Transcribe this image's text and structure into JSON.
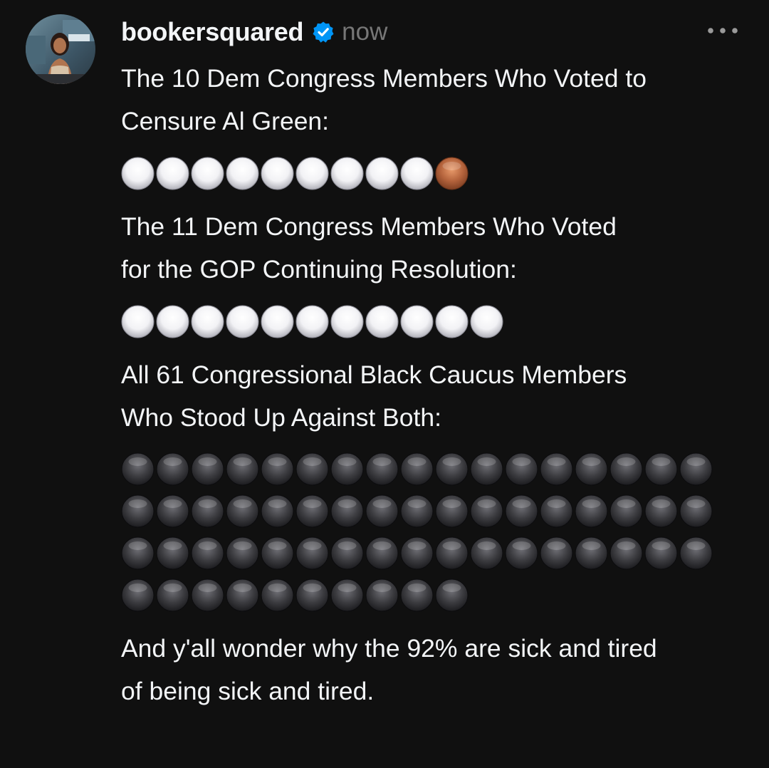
{
  "post": {
    "username": "bookersquared",
    "timestamp": "now",
    "verified": true,
    "more_icon": "more-horizontal-icon",
    "paragraphs": {
      "p1": "The 10 Dem Congress Members Who Voted to\nCensure Al Green:",
      "p2": "The 11 Dem Congress Members Who Voted\nfor the GOP Continuing Resolution:",
      "p3": "All 61 Congressional Black Caucus Members\nWho Stood Up Against Both:",
      "p4": "And y'all wonder why the 92% are sick and tired\nof being sick and tired."
    },
    "emoji_groups": {
      "g1": {
        "white": 9,
        "brown": 1
      },
      "g2": {
        "white": 11
      },
      "g3": {
        "black": 61,
        "per_row": 17
      }
    }
  },
  "colors": {
    "background": "#101010",
    "text": "#f3f5f7",
    "muted": "#777777",
    "verified_badge": "#0095f6",
    "white_circle": "#f2f2f5",
    "brown_circle": "#b4633c",
    "black_circle": "#3b3b3f"
  }
}
